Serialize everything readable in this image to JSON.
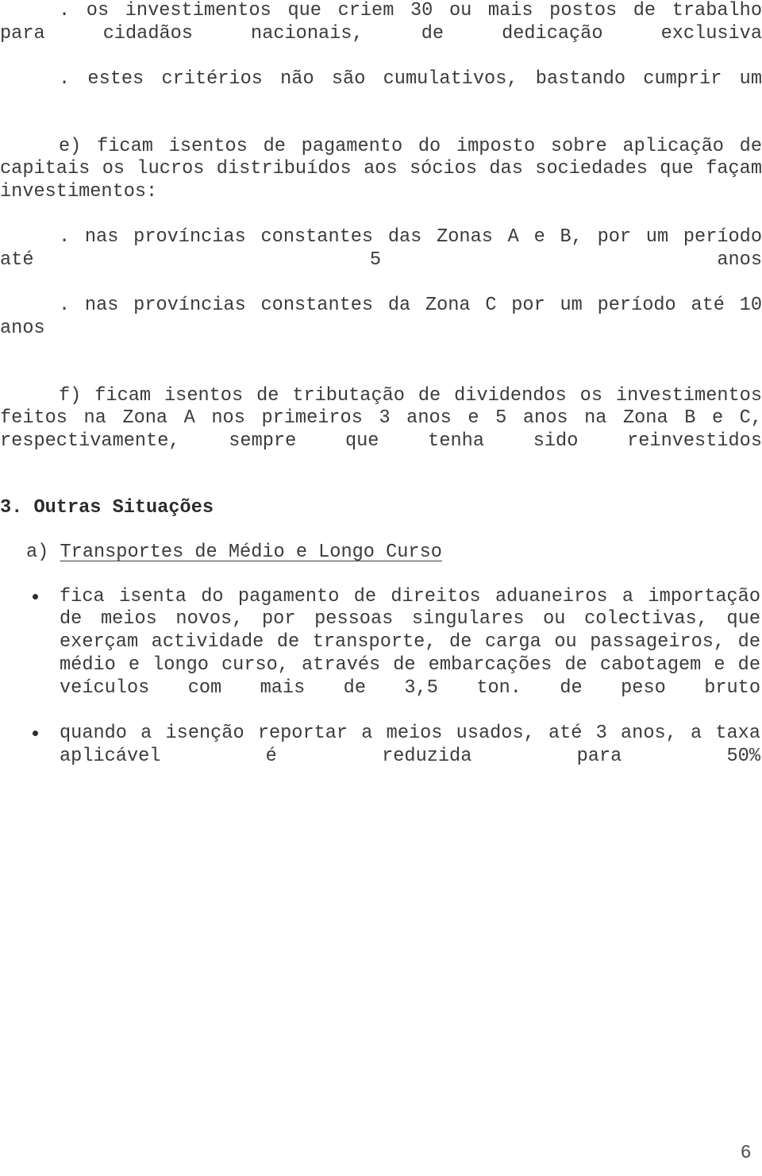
{
  "document": {
    "page_number": "6",
    "language": "pt",
    "text_color": "#3b3b3b",
    "background_color": "#ffffff"
  },
  "body": {
    "criteria_items": [
      ". os investimentos que criem 30 ou mais postos de trabalho para cidadãos nacionais, de dedicação exclusiva",
      ". estes critérios não são cumulativos, bastando cumprir um"
    ],
    "item_e": {
      "intro": "e) ficam isentos de pagamento do imposto sobre aplicação de capitais os lucros distribuídos aos sócios das sociedades que façam investimentos:",
      "sub_items": [
        ". nas províncias constantes das Zonas A e B, por um período até 5 anos",
        ". nas províncias constantes da Zona C por um período até 10 anos"
      ]
    },
    "item_f": {
      "text": "f) ficam isentos de tributação de dividendos os investimentos feitos na Zona A nos primeiros 3 anos e 5 anos na Zona B e C, respectivamente, sempre que tenha sido reinvestidos"
    }
  },
  "section": {
    "heading": "3. Outras Situações",
    "subsection": {
      "label": "a)",
      "title": "Transportes de Médio e Longo Curso"
    },
    "bullets": [
      "fica isenta do pagamento de direitos aduaneiros a importação de meios novos, por pessoas singulares ou colectivas, que exerçam actividade de transporte, de carga ou passageiros, de médio e longo curso, através de embarcações de cabotagem e de veículos com mais de 3,5 ton. de peso bruto",
      "quando a isenção reportar a meios usados, até 3 anos, a taxa aplicável é reduzida para 50%"
    ]
  }
}
